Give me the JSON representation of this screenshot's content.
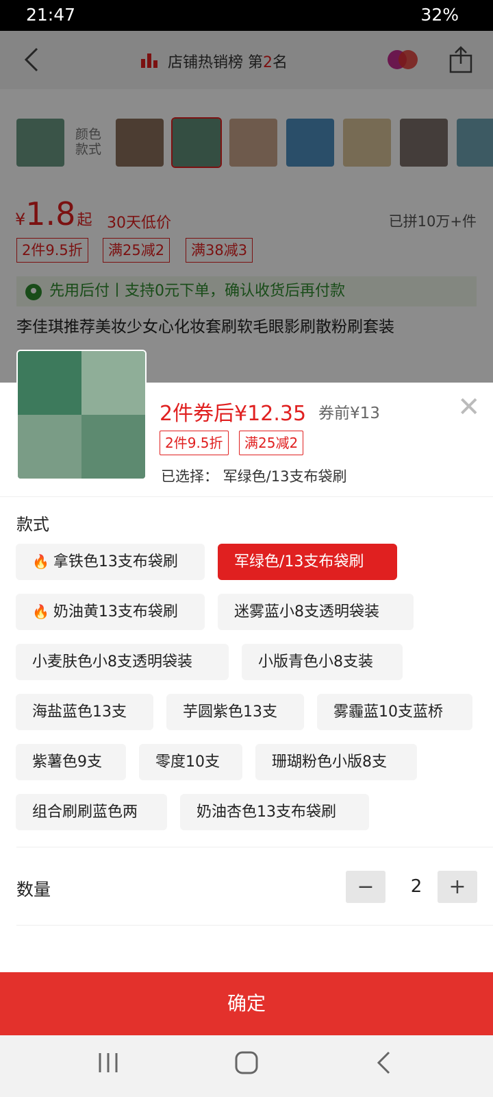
{
  "status_bar": {
    "time": "21:47",
    "battery": "32%"
  },
  "page": {
    "rank_label": "店铺热销榜 第",
    "rank_number": "2",
    "rank_suffix": "名",
    "color_style_label": "颜色款式",
    "price": {
      "yen": "¥",
      "amount": "1.8",
      "suffix": "起",
      "low_tag": "30天低价"
    },
    "sold": "已拼10万+件",
    "promo_tags": [
      "2件9.5折",
      "满25减2",
      "满38减3"
    ],
    "pay_later": "先用后付丨支持0元下单，确认收货后再付款",
    "title": "李佳琪推荐美妆少女心化妆套刷软毛眼影刷散粉刷套装"
  },
  "sheet": {
    "coupon_price": "2件券后¥12.35",
    "pre_coupon": "券前¥13",
    "tags": [
      "2件9.5折",
      "满25减2"
    ],
    "selected": "已选择：  军绿色/13支布袋刷",
    "style_label": "款式",
    "options": [
      "拿铁色13支布袋刷",
      "军绿色/13支布袋刷",
      "奶油黄13支布袋刷",
      "迷雾蓝小8支透明袋装",
      "小麦肤色小8支透明袋装",
      "小版青色小8支装",
      "海盐蓝色13支",
      "芋圆紫色13支",
      "雾霾蓝10支蓝桥",
      "紫薯色9支",
      "零度10支",
      "珊瑚粉色小版8支",
      "组合刷刷蓝色两",
      "奶油杏色13支布袋刷"
    ],
    "selected_option_index": 1,
    "hot_option_indices": [
      0,
      2
    ],
    "quantity_label": "数量",
    "quantity": "2",
    "minus": "−",
    "plus": "+",
    "confirm": "确定"
  },
  "icons": {
    "close": "close-icon",
    "back": "chevron-left-icon",
    "share": "share-icon",
    "hot": "flame-icon"
  },
  "colors": {
    "accent": "#e02020",
    "confirm_bg": "#e3312c"
  }
}
